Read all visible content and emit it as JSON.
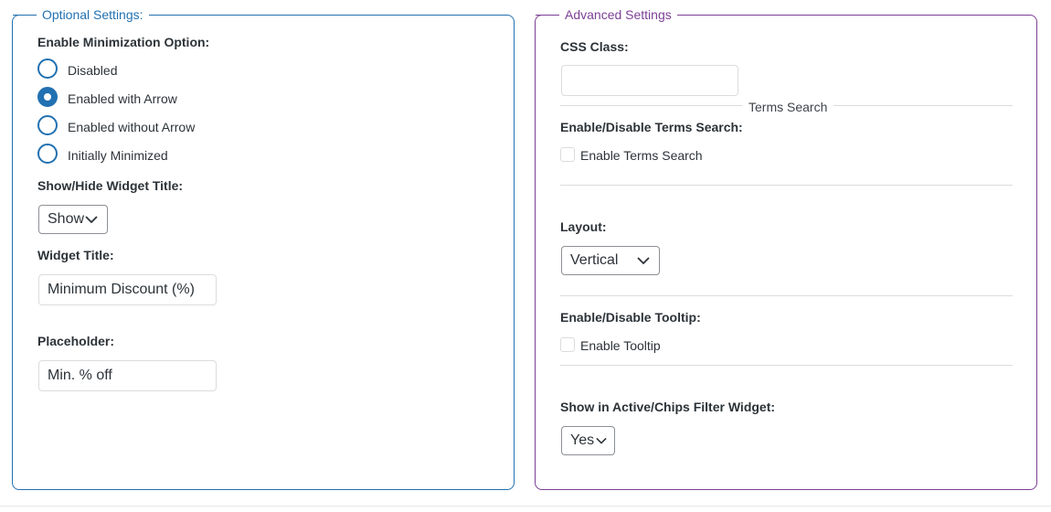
{
  "optional": {
    "legend": "Optional Settings:",
    "minimization_label": "Enable Minimization Option:",
    "radios": [
      {
        "label": "Disabled",
        "checked": false
      },
      {
        "label": "Enabled with Arrow",
        "checked": true
      },
      {
        "label": "Enabled without Arrow",
        "checked": false
      },
      {
        "label": "Initially Minimized",
        "checked": false
      }
    ],
    "title_visibility_label": "Show/Hide Widget Title:",
    "title_visibility_value": "Show",
    "widget_title_label": "Widget Title:",
    "widget_title_value": "Minimum Discount (%)",
    "placeholder_label": "Placeholder:",
    "placeholder_value": "Min. % off"
  },
  "advanced": {
    "legend": "Advanced Settings",
    "css_class_label": "CSS Class:",
    "css_class_value": "",
    "terms_search_divider": "Terms Search",
    "terms_search_label": "Enable/Disable Terms Search:",
    "terms_search_checkbox": "Enable Terms Search",
    "layout_label": "Layout:",
    "layout_value": "Vertical",
    "tooltip_label": "Enable/Disable Tooltip:",
    "tooltip_checkbox": "Enable Tooltip",
    "chips_label": "Show in Active/Chips Filter Widget:",
    "chips_value": "Yes"
  },
  "colors": {
    "optional_accent": "#2271b1",
    "advanced_accent": "#7b3f95"
  }
}
